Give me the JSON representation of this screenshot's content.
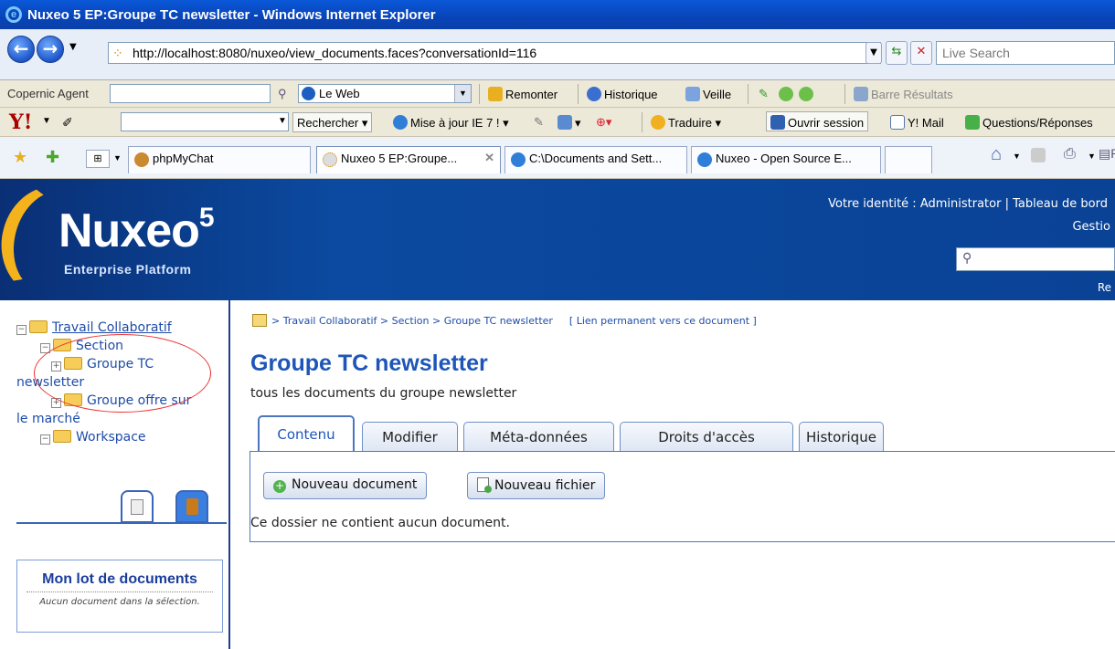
{
  "window": {
    "title": "Nuxeo 5 EP:Groupe TC newsletter - Windows Internet Explorer"
  },
  "address": {
    "url": "http://localhost:8080/nuxeo/view_documents.faces?conversationId=116",
    "live_search_placeholder": "Live Search"
  },
  "toolbar1": {
    "copernic_label": "Copernic Agent",
    "web_select": "Le Web",
    "remonter": "Remonter",
    "historique": "Historique",
    "veille": "Veille",
    "barre": "Barre Résultats"
  },
  "toolbar2": {
    "rechercher": "Rechercher",
    "mise_a_jour": "Mise à jour IE 7 !",
    "traduire": "Traduire",
    "ouvrir_session": "Ouvrir session",
    "ymail": "Y! Mail",
    "questions": "Questions/Réponses"
  },
  "browser_tabs": [
    {
      "label": "phpMyChat"
    },
    {
      "label": "Nuxeo 5 EP:Groupe..."
    },
    {
      "label": "C:\\Documents and Sett..."
    },
    {
      "label": "Nuxeo - Open Source E..."
    }
  ],
  "header": {
    "logo": "Nuxeo",
    "logo_sup": "5",
    "logo_sub": "Enterprise Platform",
    "identity": "Votre identité : Administrator | Tableau de bord",
    "gestion": "Gestio",
    "re": "Re"
  },
  "tree": {
    "root": "Travail Collaboratif",
    "section": "Section",
    "groupe_tc_1": "Groupe TC",
    "groupe_tc_2": "newsletter",
    "groupe_offre_1": "Groupe offre sur",
    "groupe_offre_2": "le marché",
    "workspace": "Workspace"
  },
  "lot": {
    "title": "Mon lot de documents",
    "text": "Aucun document dans la sélection."
  },
  "breadcrumb": {
    "path": "> Travail Collaboratif > Section > Groupe TC newsletter",
    "permalink": "[ Lien permanent vers ce document ]"
  },
  "page": {
    "title": "Groupe TC newsletter",
    "description": "tous les documents du groupe newsletter"
  },
  "tabs": [
    "Contenu",
    "Modifier",
    "Méta-données",
    "Droits d'accès",
    "Historique"
  ],
  "actions": {
    "new_doc": "Nouveau document",
    "new_file": "Nouveau fichier"
  },
  "empty_message": "Ce dossier ne contient aucun document.",
  "colors": {
    "brand_blue": "#1e55b8",
    "header_bg": "#0a3d8c",
    "accent_orange": "#f4b21c",
    "circle_red": "#e33333"
  }
}
